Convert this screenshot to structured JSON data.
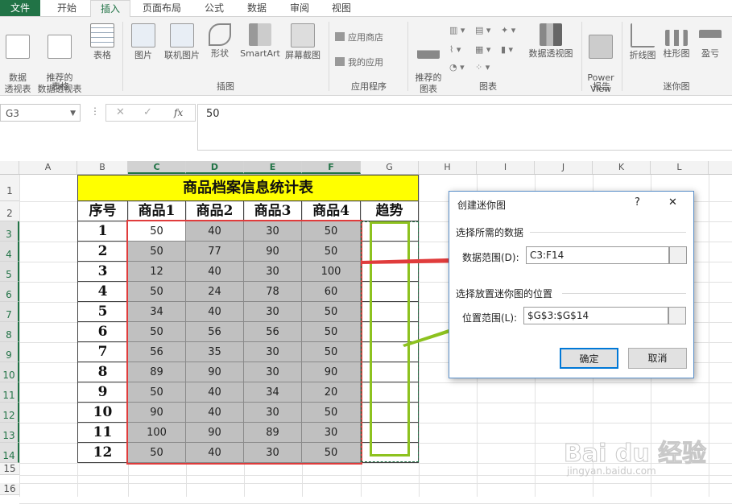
{
  "ribbon": {
    "tabs": [
      "文件",
      "开始",
      "插入",
      "页面布局",
      "公式",
      "数据",
      "审阅",
      "视图"
    ],
    "active_tab": "插入",
    "groups": {
      "tables": {
        "label": "表格",
        "buttons": [
          "数据\n透视表",
          "推荐的\n数据透视表",
          "表格"
        ]
      },
      "illustrations": {
        "label": "插图",
        "buttons": [
          "图片",
          "联机图片",
          "形状",
          "SmartArt",
          "屏幕截图"
        ]
      },
      "apps": {
        "label": "应用程序",
        "buttons": [
          "应用商店",
          "我的应用"
        ]
      },
      "charts": {
        "label": "图表",
        "buttons": [
          "推荐的\n图表",
          "数据透视图"
        ]
      },
      "reports": {
        "label": "报告",
        "buttons": [
          "Power\nView"
        ]
      },
      "sparklines": {
        "label": "迷你图",
        "buttons": [
          "折线图",
          "柱形图",
          "盈亏"
        ]
      }
    }
  },
  "formula_bar": {
    "name_box": "G3",
    "fx": "fx",
    "value": "50"
  },
  "columns": [
    "A",
    "B",
    "C",
    "D",
    "E",
    "F",
    "G",
    "H",
    "I",
    "J",
    "K",
    "L"
  ],
  "rows": [
    "1",
    "2",
    "3",
    "4",
    "5",
    "6",
    "7",
    "8",
    "9",
    "10",
    "11",
    "12",
    "13",
    "14",
    "15",
    "16"
  ],
  "sheet": {
    "title": "商品档案信息统计表",
    "headers": [
      "序号",
      "商品1",
      "商品2",
      "商品3",
      "商品4",
      "趋势"
    ],
    "data": [
      [
        "1",
        "50",
        "40",
        "30",
        "50"
      ],
      [
        "2",
        "50",
        "77",
        "90",
        "50"
      ],
      [
        "3",
        "12",
        "40",
        "30",
        "100"
      ],
      [
        "4",
        "50",
        "24",
        "78",
        "60"
      ],
      [
        "5",
        "34",
        "40",
        "30",
        "50"
      ],
      [
        "6",
        "50",
        "56",
        "56",
        "50"
      ],
      [
        "7",
        "56",
        "35",
        "30",
        "50"
      ],
      [
        "8",
        "89",
        "90",
        "30",
        "90"
      ],
      [
        "9",
        "50",
        "40",
        "34",
        "20"
      ],
      [
        "10",
        "90",
        "40",
        "30",
        "50"
      ],
      [
        "11",
        "100",
        "90",
        "89",
        "30"
      ],
      [
        "12",
        "50",
        "40",
        "30",
        "50"
      ]
    ]
  },
  "dialog": {
    "title": "创建迷你图",
    "help": "?",
    "close": "✕",
    "section1": "选择所需的数据",
    "data_range_label": "数据范围(D):",
    "data_range_value": "C3:F14",
    "section2": "选择放置迷你图的位置",
    "location_label": "位置范围(L):",
    "location_value": "$G$3:$G$14",
    "ok": "确定",
    "cancel": "取消"
  },
  "watermark": {
    "brand": "Bai du 经验",
    "url": "jingyan.baidu.com"
  },
  "colors": {
    "excel_green": "#217346",
    "title_fill": "#ffff00",
    "data_fill": "#c0c0c0",
    "red_outline": "#e03c3c",
    "green_outline": "#8dc21f"
  }
}
